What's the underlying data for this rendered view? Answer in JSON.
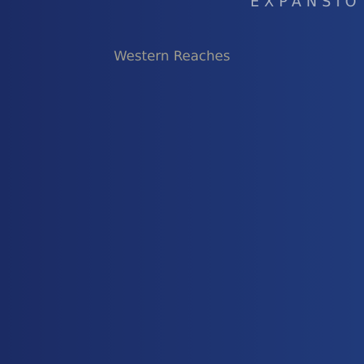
{
  "header": {
    "expansion_label": "EXPANSIO"
  },
  "map": {
    "region_name": "Western Reaches"
  },
  "colors": {
    "background_left": "#1b2b64",
    "background_right": "#203a7a",
    "expansion_text": "#a8b0c0",
    "region_text": "#9c9a8c"
  }
}
